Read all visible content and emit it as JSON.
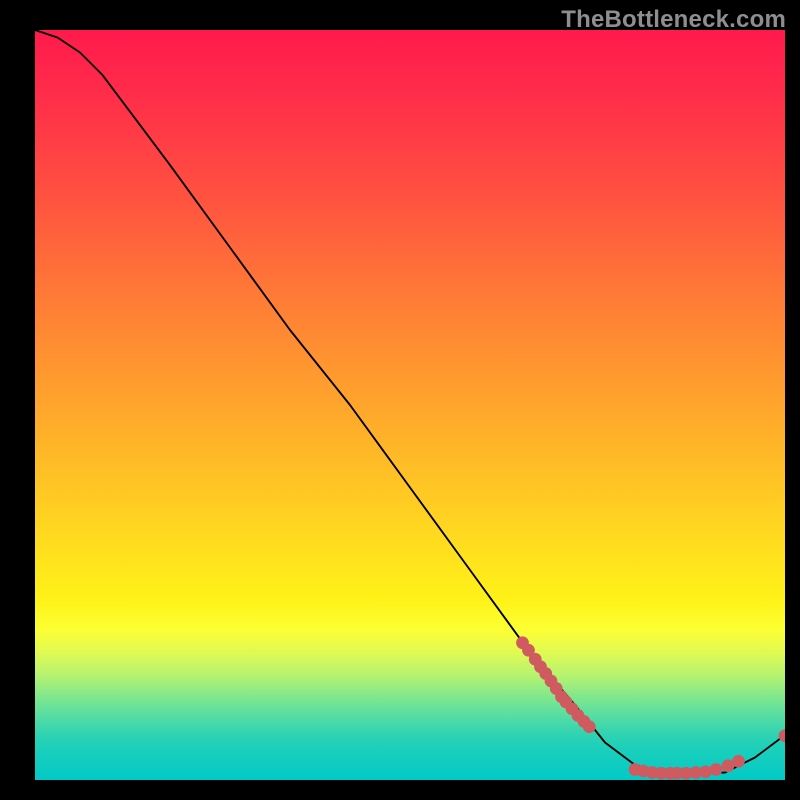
{
  "watermark": "TheBottleneck.com",
  "chart_data": {
    "type": "line",
    "title": "",
    "xlabel": "",
    "ylabel": "",
    "xlim": [
      0,
      100
    ],
    "ylim": [
      0,
      100
    ],
    "grid": false,
    "series": [
      {
        "name": "curve",
        "x": [
          0,
          3,
          6,
          9,
          12,
          18,
          26,
          34,
          42,
          50,
          58,
          66,
          72,
          76,
          80,
          84,
          88,
          92,
          96,
          100
        ],
        "y": [
          100,
          99,
          97,
          94,
          90,
          82,
          71,
          60,
          50,
          39,
          28,
          17,
          10,
          5,
          2,
          1,
          1,
          1,
          3,
          6
        ]
      }
    ],
    "marker_clusters": [
      {
        "name": "upper-cluster",
        "color": "#cf5b61",
        "x": [
          65,
          65.8,
          66.7,
          67.4,
          68.1,
          68.8,
          69.5,
          70.2,
          70.8,
          71.6,
          72.4,
          73.2,
          73.9
        ],
        "y": [
          18.3,
          17.3,
          16.1,
          15.1,
          14.2,
          13.2,
          12.2,
          11.1,
          10.4,
          9.5,
          8.6,
          7.8,
          7.1
        ]
      },
      {
        "name": "lower-cluster",
        "color": "#cf5b61",
        "x": [
          80,
          81.1,
          82.3,
          83.5,
          84.7,
          85.6,
          86.8,
          88.1,
          89.4,
          90.8,
          92.4,
          93.8
        ],
        "y": [
          1.4,
          1.2,
          1.0,
          0.9,
          0.9,
          0.9,
          0.9,
          1.0,
          1.1,
          1.4,
          1.9,
          2.5
        ]
      },
      {
        "name": "end-point",
        "color": "#cf5b61",
        "x": [
          100
        ],
        "y": [
          5.9
        ]
      }
    ]
  }
}
